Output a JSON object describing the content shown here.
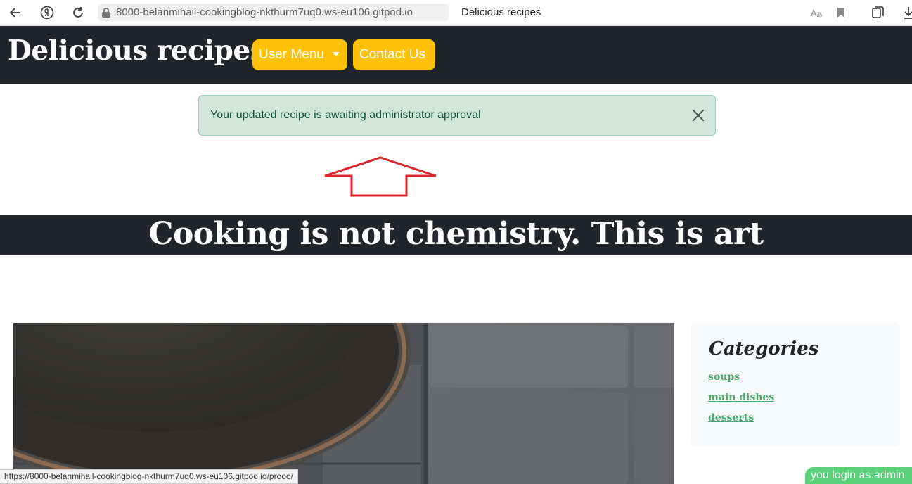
{
  "browser": {
    "url": "8000-belanmihail-cookingblog-nkthurm7uq0.ws-eu106.gitpod.io",
    "tab_title": "Delicious recipes",
    "status_url": "https://8000-belanmihail-cookingblog-nkthurm7uq0.ws-eu106.gitpod.io/prooo/"
  },
  "header": {
    "brand": "Delicious recipes",
    "user_menu_label": "User Menu",
    "contact_label": "Contact Us"
  },
  "alert": {
    "message": "Your updated recipe is awaiting administrator approval"
  },
  "banner": {
    "text": "Cooking is not chemistry. This is art"
  },
  "sidebar": {
    "categories_title": "Categories",
    "categories": [
      {
        "label": "soups"
      },
      {
        "label": "main dishes"
      },
      {
        "label": "desserts"
      }
    ]
  },
  "login_badge": "you login as admin",
  "colors": {
    "header_bg": "#212529",
    "nav_button": "#ffc107",
    "alert_bg": "#d1e7dd",
    "link": "#4ea86a",
    "annotation_arrow": "#d9262c",
    "login_badge": "#5ad07a"
  },
  "icons": [
    "back-arrow-icon",
    "yandex-icon",
    "reload-icon",
    "lock-icon",
    "translate-icon",
    "bookmark-icon",
    "collections-icon",
    "download-icon",
    "close-icon",
    "caret-down-icon"
  ]
}
